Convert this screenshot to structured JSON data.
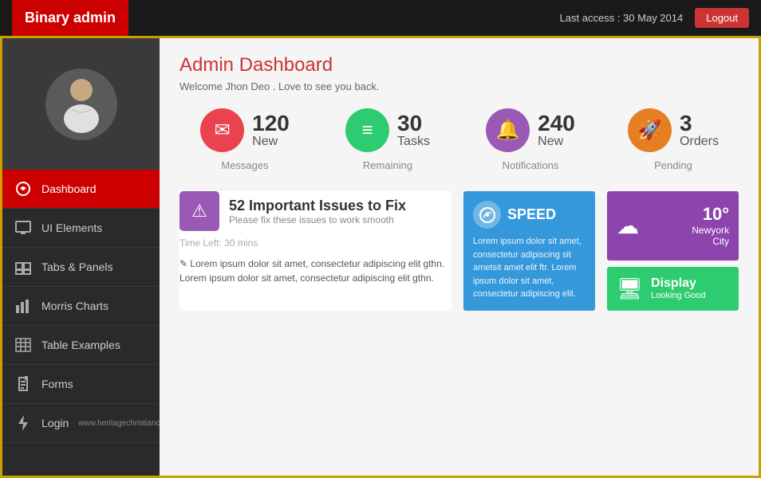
{
  "header": {
    "brand": "Binary admin",
    "last_access": "Last access : 30 May 2014",
    "logout_label": "Logout"
  },
  "sidebar": {
    "nav_items": [
      {
        "id": "dashboard",
        "label": "Dashboard",
        "icon": "🎨",
        "active": true
      },
      {
        "id": "ui-elements",
        "label": "UI Elements",
        "icon": "🖥",
        "active": false
      },
      {
        "id": "tabs-panels",
        "label": "Tabs & Panels",
        "icon": "⊞",
        "active": false
      },
      {
        "id": "morris-charts",
        "label": "Morris Charts",
        "icon": "📊",
        "active": false
      },
      {
        "id": "table-examples",
        "label": "Table Examples",
        "icon": "⊟",
        "active": false
      },
      {
        "id": "forms",
        "label": "Forms",
        "icon": "✎",
        "active": false
      },
      {
        "id": "login",
        "label": "Login",
        "icon": "⚡",
        "active": false
      }
    ]
  },
  "content": {
    "page_title": "Admin Dashboard",
    "welcome_text": "Welcome Jhon Deo . Love to see you back.",
    "stats": [
      {
        "id": "messages",
        "number": "120",
        "label_top": "New",
        "label_bottom": "Messages",
        "icon": "✉",
        "color": "red"
      },
      {
        "id": "tasks",
        "number": "30",
        "label_top": "Tasks",
        "label_bottom": "Remaining",
        "icon": "≡",
        "color": "green"
      },
      {
        "id": "notifications",
        "number": "240",
        "label_top": "New",
        "label_bottom": "Notifications",
        "icon": "🔔",
        "color": "purple"
      },
      {
        "id": "orders",
        "number": "3",
        "label_top": "Orders",
        "label_bottom": "Pending",
        "icon": "🚀",
        "color": "orange"
      }
    ],
    "issues": {
      "title": "52 Important Issues to Fix",
      "subtitle": "Please fix these issues to work smooth",
      "time_left": "Time Left: 30 mins",
      "body_text": "Lorem ipsum dolor sit amet, consectetur adipiscing elit gthn. Lorem ipsum dolor sit amet, consectetur adipiscing elit gthn."
    },
    "speed": {
      "title": "SPEED",
      "text": "Lorem ipsum dolor sit amet, consectetur adipiscing sit ametsit amet elit ftr. Lorem ipsum dolor sit amet, consectetur adipiscing elit."
    },
    "weather": {
      "temp": "10°",
      "city_line1": "Newyork",
      "city_line2": "City"
    },
    "display": {
      "label": "Display",
      "sub": "Looking Good"
    }
  },
  "footer": {
    "url": "www.heritagechristiancollege.com"
  }
}
